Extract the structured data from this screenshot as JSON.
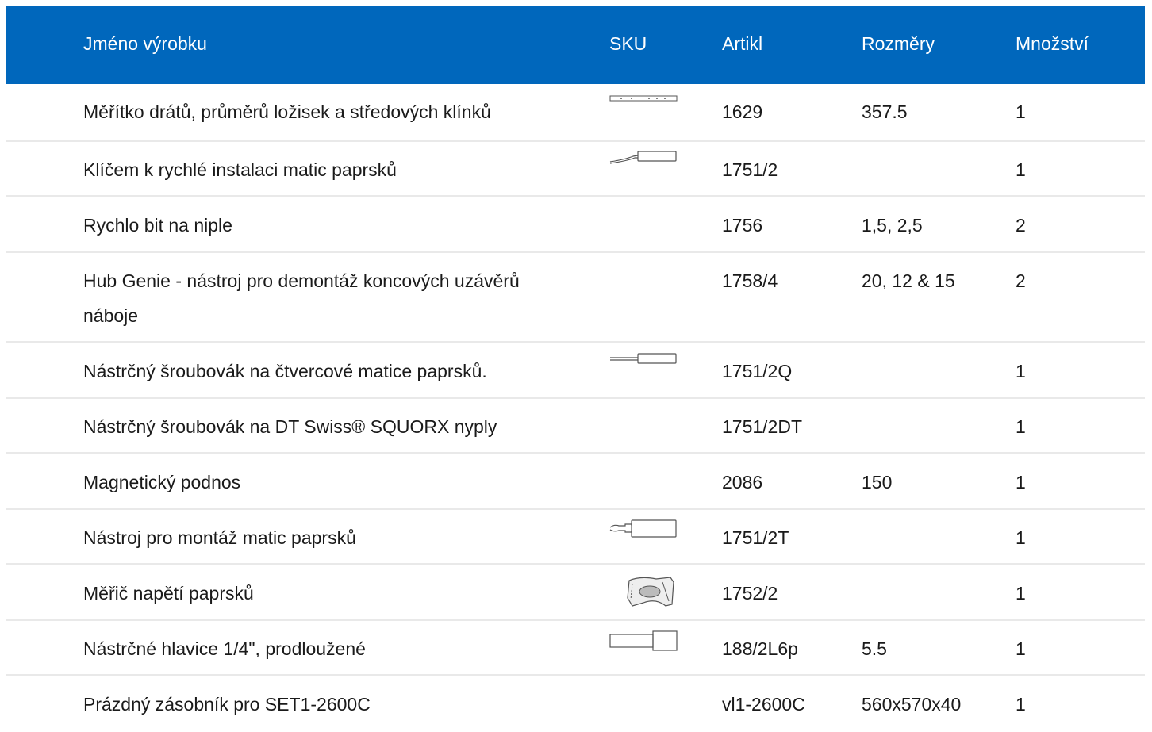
{
  "header": {
    "name": "Jméno výrobku",
    "sku": "SKU",
    "article": "Artikl",
    "dimensions": "Rozměry",
    "quantity": "Množství"
  },
  "rows": [
    {
      "name": "Měřítko drátů, průměrů ložisek a středových klínků",
      "article": "1629",
      "dimensions": "357.5",
      "quantity": "1",
      "icon": "ruler-icon"
    },
    {
      "name": "Klíčem k rychlé instalaci matic paprsků",
      "article": "1751/2",
      "dimensions": "",
      "quantity": "1",
      "icon": "hook-tool-icon"
    },
    {
      "name": "Rychlo bit na niple",
      "article": "1756",
      "dimensions": "1,5, 2,5",
      "quantity": "2",
      "icon": ""
    },
    {
      "name": "Hub Genie - nástroj pro demontáž koncových uzávěrů náboje",
      "article": "1758/4",
      "dimensions": "20, 12 & 15",
      "quantity": "2",
      "icon": ""
    },
    {
      "name": "Nástrčný šroubovák na čtvercové matice paprsků.",
      "article": "1751/2Q",
      "dimensions": "",
      "quantity": "1",
      "icon": "screwdriver-icon"
    },
    {
      "name": "Nástrčný šroubovák na DT Swiss® SQUORX nyply",
      "article": "1751/2DT",
      "dimensions": "",
      "quantity": "1",
      "icon": ""
    },
    {
      "name": "Magnetický podnos",
      "article": "2086",
      "dimensions": "150",
      "quantity": "1",
      "icon": ""
    },
    {
      "name": "Nástroj pro montáž matic paprsků",
      "article": "1751/2T",
      "dimensions": "",
      "quantity": "1",
      "icon": "nipple-tool-icon"
    },
    {
      "name": "Měřič napětí paprsků",
      "article": "1752/2",
      "dimensions": "",
      "quantity": "1",
      "icon": "tension-meter-icon"
    },
    {
      "name": "Nástrčné hlavice 1/4\", prodloužené",
      "article": "188/2L6p",
      "dimensions": "5.5",
      "quantity": "1",
      "icon": "socket-icon"
    },
    {
      "name": "Prázdný zásobník pro SET1-2600C",
      "article": "vl1-2600C",
      "dimensions": "560x570x40",
      "quantity": "1",
      "icon": ""
    }
  ]
}
